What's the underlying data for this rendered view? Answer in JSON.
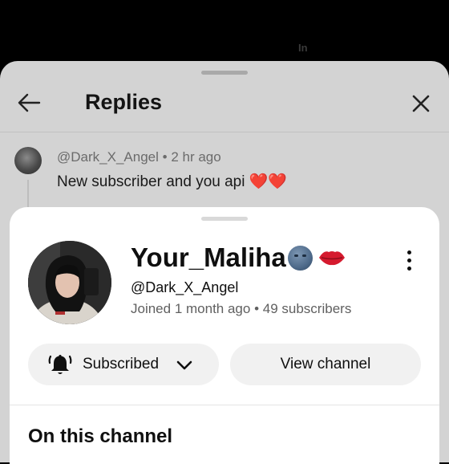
{
  "background": {
    "top_hint": "In"
  },
  "replies": {
    "title": "Replies",
    "comment": {
      "handle": "@Dark_X_Angel",
      "separator": "•",
      "time": "2 hr ago",
      "text": "New subscriber and you api",
      "hearts": "❤️❤️"
    }
  },
  "channel": {
    "name": "Your_Maliha",
    "name_emojis": [
      "new-moon-face",
      "kiss-lips"
    ],
    "handle": "@Dark_X_Angel",
    "joined": "Joined 1 month ago",
    "separator": "•",
    "subscribers": "49 subscribers",
    "subscribe_button": "Subscribed",
    "view_channel_button": "View channel",
    "section_title": "On this channel"
  },
  "colors": {
    "sheet_bg": "#ffffff",
    "dim_bg": "#d3d3d3",
    "button_bg": "#f1f1f1",
    "heart_red": "#c0171b"
  }
}
